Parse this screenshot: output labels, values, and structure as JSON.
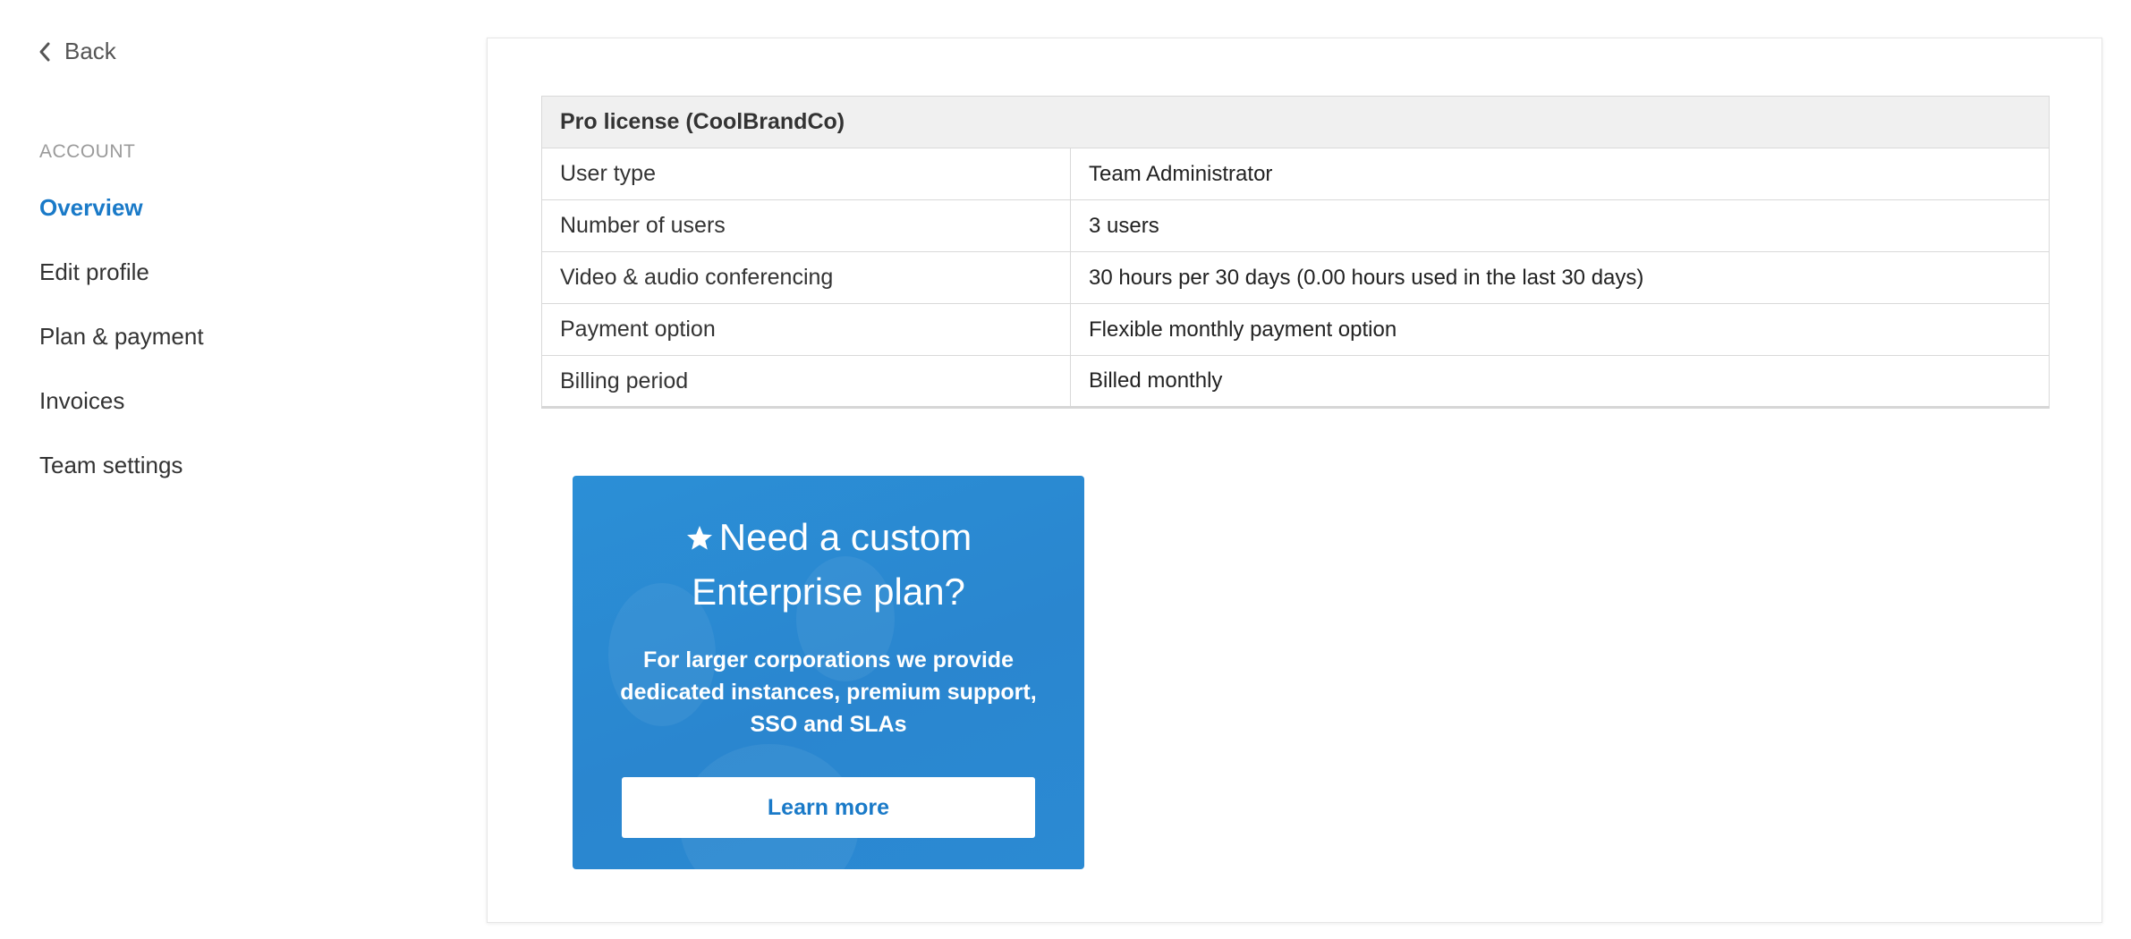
{
  "sidebar": {
    "back_label": "Back",
    "section_label": "ACCOUNT",
    "items": [
      {
        "label": "Overview",
        "active": true
      },
      {
        "label": "Edit profile",
        "active": false
      },
      {
        "label": "Plan & payment",
        "active": false
      },
      {
        "label": "Invoices",
        "active": false
      },
      {
        "label": "Team settings",
        "active": false
      }
    ]
  },
  "license_table": {
    "title": "Pro license (CoolBrandCo)",
    "rows": [
      {
        "label": "User type",
        "value": "Team Administrator"
      },
      {
        "label": "Number of users",
        "value": "3 users"
      },
      {
        "label": "Video & audio conferencing",
        "value": "30 hours per 30 days (0.00 hours used in the last 30 days)"
      },
      {
        "label": "Payment option",
        "value": "Flexible monthly payment option"
      },
      {
        "label": "Billing period",
        "value": "Billed monthly"
      }
    ]
  },
  "promo": {
    "icon": "star-icon",
    "title_line1": "Need a custom",
    "title_line2": "Enterprise plan?",
    "text": "For larger corporations we provide dedicated instances, premium support, SSO and SLAs",
    "button_label": "Learn more"
  },
  "colors": {
    "accent": "#1a7ac8",
    "promo_bg": "#2a86cf",
    "table_header_bg": "#f0f0f0"
  }
}
